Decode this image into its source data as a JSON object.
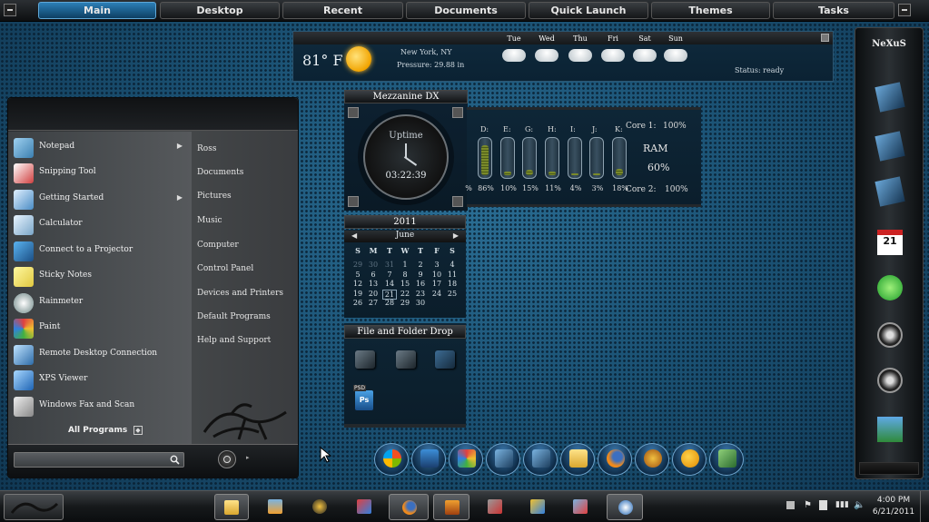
{
  "topbar": {
    "tabs": [
      "Main",
      "Desktop",
      "Recent",
      "Documents",
      "Quick Launch",
      "Themes",
      "Tasks"
    ],
    "active": "Main"
  },
  "weather": {
    "temp": "81° F",
    "city": "New York, NY",
    "pressure": "Pressure: 29.88 in",
    "status": "Status: ready",
    "days": [
      "Tue",
      "Wed",
      "Thu",
      "Fri",
      "Sat",
      "Sun"
    ],
    "forecast_icons": [
      "cloud-icon",
      "cloud-icon",
      "cloud-icon",
      "partly-sunny-icon",
      "partly-sunny-icon",
      "partly-sunny-icon"
    ]
  },
  "start_menu": {
    "programs": [
      {
        "label": "Notepad",
        "icon": "notepad-icon",
        "submenu": true
      },
      {
        "label": "Snipping Tool",
        "icon": "scissors-icon",
        "submenu": false
      },
      {
        "label": "Getting Started",
        "icon": "getting-started-icon",
        "submenu": true
      },
      {
        "label": "Calculator",
        "icon": "calculator-icon",
        "submenu": false
      },
      {
        "label": "Connect to a Projector",
        "icon": "projector-icon",
        "submenu": false
      },
      {
        "label": "Sticky Notes",
        "icon": "sticky-notes-icon",
        "submenu": false
      },
      {
        "label": "Rainmeter",
        "icon": "rainmeter-drop-icon",
        "submenu": false
      },
      {
        "label": "Paint",
        "icon": "paint-palette-icon",
        "submenu": false
      },
      {
        "label": "Remote Desktop Connection",
        "icon": "remote-desktop-icon",
        "submenu": false
      },
      {
        "label": "XPS Viewer",
        "icon": "xps-viewer-icon",
        "submenu": false
      },
      {
        "label": "Windows Fax and Scan",
        "icon": "fax-icon",
        "submenu": false
      }
    ],
    "all_programs": "All Programs",
    "places": [
      "Ross",
      "Documents",
      "Pictures",
      "Music",
      "Computer",
      "Control Panel",
      "Devices and Printers",
      "Default Programs",
      "Help and Support"
    ],
    "search_placeholder": ""
  },
  "uptime": {
    "title": "Mezzanine DX",
    "label": "Uptime",
    "value": "03:22:39"
  },
  "drives": {
    "labels": [
      "D:",
      "E:",
      "G:",
      "H:",
      "I:",
      "J:",
      "K:"
    ],
    "percents": [
      "86%",
      "10%",
      "15%",
      "11%",
      "4%",
      "3%",
      "18%"
    ],
    "fill": [
      0.86,
      0.1,
      0.15,
      0.11,
      0.04,
      0.03,
      0.18
    ],
    "leading_percent": "%",
    "core1": "Core 1:",
    "core1_val": "100%",
    "ram_label": "RAM",
    "ram_val": "60%",
    "core2": "Core 2:",
    "core2_val": "100%"
  },
  "calendar": {
    "year": "2011",
    "month": "June",
    "weekdays": [
      "S",
      "M",
      "T",
      "W",
      "T",
      "F",
      "S"
    ],
    "rows": [
      [
        "29",
        "30",
        "31",
        "1",
        "2",
        "3",
        "4"
      ],
      [
        "5",
        "6",
        "7",
        "8",
        "9",
        "10",
        "11"
      ],
      [
        "12",
        "13",
        "14",
        "15",
        "16",
        "17",
        "18"
      ],
      [
        "19",
        "20",
        "21",
        "22",
        "23",
        "24",
        "25"
      ],
      [
        "26",
        "27",
        "28",
        "29",
        "30",
        "",
        ""
      ]
    ],
    "today": "21"
  },
  "drop": {
    "title": "File and Folder Drop",
    "badge": "PSD"
  },
  "nexus": {
    "logo": "NeXuS",
    "icons": [
      "computer-icon",
      "drive-icon",
      "drive-icon",
      "calendar-icon",
      "recycle-bin-icon",
      "gauge-icon",
      "gauge-icon",
      "photo-icon"
    ],
    "calendar_day": "21"
  },
  "dock": {
    "icons": [
      "windows-orb-icon",
      "photoshop-icon",
      "paint-icon",
      "drive-icon",
      "drive-icon",
      "folder-icon",
      "firefox-icon",
      "gimp-icon",
      "weather-icon",
      "settings-icon"
    ]
  },
  "taskbar": {
    "time": "4:00 PM",
    "date": "6/21/2011"
  }
}
